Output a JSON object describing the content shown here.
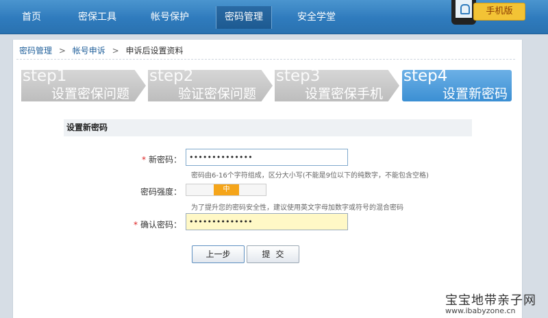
{
  "nav": {
    "items": [
      "首页",
      "密保工具",
      "帐号保护",
      "密码管理",
      "安全学堂"
    ],
    "active_index": 3,
    "mobile_badge": "手机版"
  },
  "breadcrumb": [
    "密码管理",
    "帐号申诉",
    "申诉后设置资料"
  ],
  "breadcrumb_separator": ">",
  "steps": [
    {
      "num": "step1",
      "text": "设置密保问题",
      "state": "inactive"
    },
    {
      "num": "step2",
      "text": "验证密保问题",
      "state": "inactive"
    },
    {
      "num": "step3",
      "text": "设置密保手机",
      "state": "inactive"
    },
    {
      "num": "step4",
      "text": "设置新密码",
      "state": "current"
    }
  ],
  "form": {
    "section_title": "设置新密码",
    "new_password": {
      "required_mark": "*",
      "label": "新密码：",
      "value": "••••••••••••••",
      "hint": "密码由6-16个字符组成，区分大小写(不能是9位以下的纯数字，不能包含空格)"
    },
    "strength": {
      "label": "密码强度：",
      "level_text": "中",
      "hint": "为了提升您的密码安全性，建议使用英文字母加数字或符号的混合密码"
    },
    "confirm_password": {
      "required_mark": "*",
      "label": "确认密码：",
      "value": "••••••••••••••"
    },
    "buttons": {
      "prev": "上一步",
      "submit": "提交"
    }
  },
  "watermark": {
    "text": "宝宝地带亲子网",
    "url": "www.ibabyzone.cn"
  },
  "colors": {
    "nav_bg": "#2f7bbd",
    "step_current": "#4a9ad9",
    "step_inactive": "#c8c8c8",
    "strength_mid": "#f5a51a",
    "required": "#dd2222",
    "focus_bg": "#fff8c6"
  }
}
